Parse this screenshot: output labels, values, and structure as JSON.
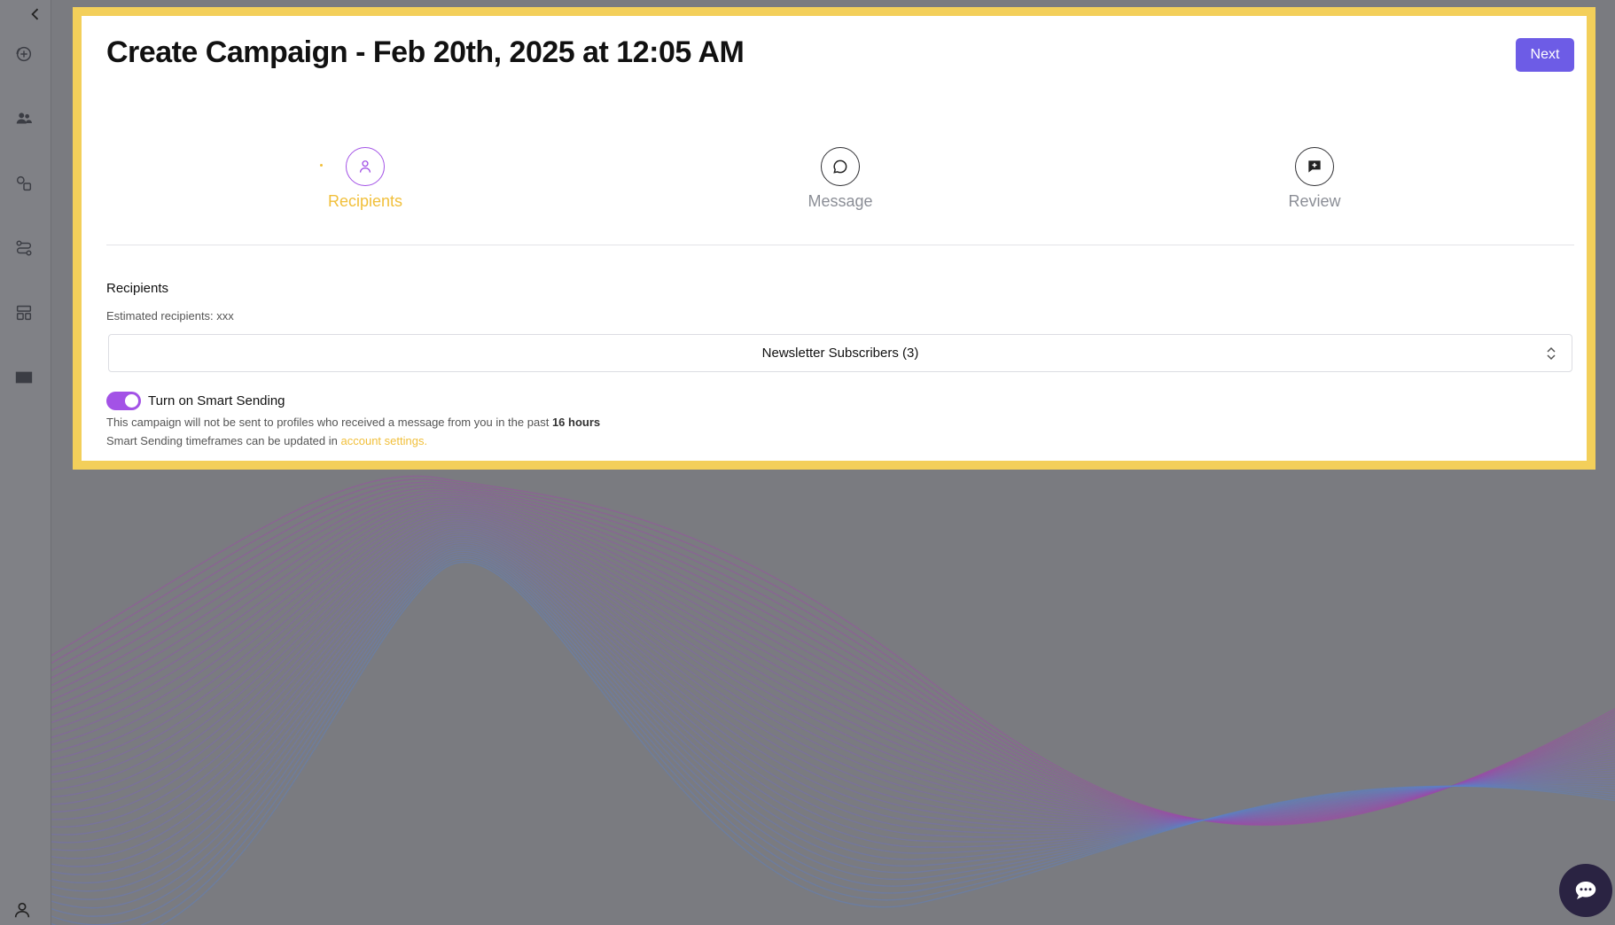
{
  "sidebar": {
    "collapse_icon": "chevron-left-icon",
    "items": [
      {
        "icon": "add-campaign-icon"
      },
      {
        "icon": "audience-icon"
      },
      {
        "icon": "shapes-icon"
      },
      {
        "icon": "flows-icon"
      },
      {
        "icon": "templates-icon"
      },
      {
        "icon": "mail-icon"
      }
    ],
    "profile_icon": "user-icon"
  },
  "modal": {
    "title": "Create Campaign - Feb 20th, 2025 at 12:05 AM",
    "next_label": "Next",
    "steps": [
      {
        "label": "Recipients",
        "icon": "user-icon",
        "active": true
      },
      {
        "label": "Message",
        "icon": "chat-bubble-icon",
        "active": false
      },
      {
        "label": "Review",
        "icon": "review-icon",
        "active": false
      }
    ],
    "recipients": {
      "section_title": "Recipients",
      "estimated": "Estimated recipients: xxx",
      "list_selected": "Newsletter Subscribers (3)"
    },
    "smart_sending": {
      "label": "Turn on Smart Sending",
      "enabled": true,
      "note_prefix": "This campaign will not be sent to profiles who received a message from you in the past",
      "note_hours": "16 hours",
      "note2_prefix": "Smart Sending timeframes can be updated in",
      "note2_link": "account settings."
    }
  },
  "colors": {
    "accent_purple": "#6d5ce6",
    "toggle_purple": "#a352e6",
    "highlight_yellow": "#f3cf5a",
    "active_step": "#f1bf3a"
  }
}
